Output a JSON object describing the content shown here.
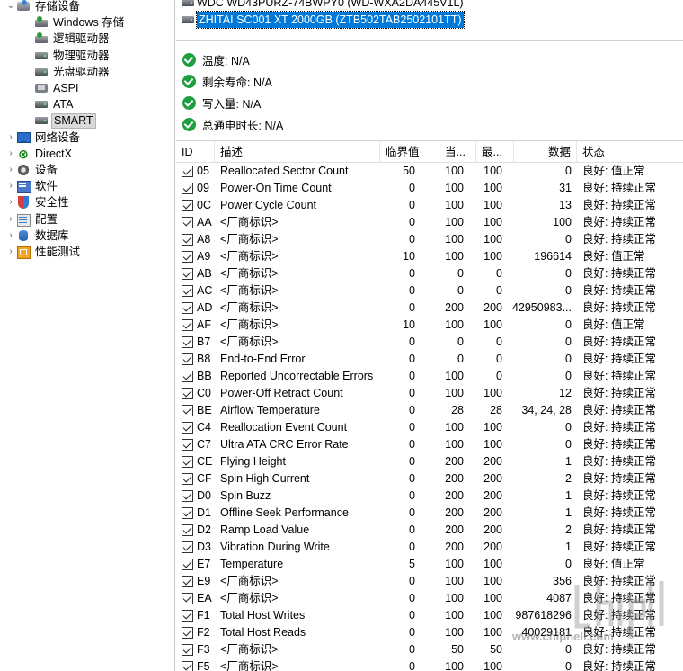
{
  "tree": {
    "items": [
      {
        "label": "存储设备",
        "icon": "storage-icon",
        "expander": "⌄",
        "indent": 0
      },
      {
        "label": "Windows 存储",
        "icon": "disk-green-icon",
        "expander": "",
        "indent": 1
      },
      {
        "label": "逻辑驱动器",
        "icon": "disk-green-icon",
        "expander": "",
        "indent": 1
      },
      {
        "label": "物理驱动器",
        "icon": "disk-icon",
        "expander": "",
        "indent": 1
      },
      {
        "label": "光盘驱动器",
        "icon": "disk-icon",
        "expander": "",
        "indent": 1
      },
      {
        "label": "ASPI",
        "icon": "aspi-icon",
        "expander": "",
        "indent": 1
      },
      {
        "label": "ATA",
        "icon": "disk-icon",
        "expander": "",
        "indent": 1
      },
      {
        "label": "SMART",
        "icon": "disk-icon",
        "expander": "",
        "indent": 1,
        "selected": true
      },
      {
        "label": "网络设备",
        "icon": "network-icon",
        "expander": "›",
        "indent": 0
      },
      {
        "label": "DirectX",
        "icon": "directx-icon",
        "expander": "›",
        "indent": 0
      },
      {
        "label": "设备",
        "icon": "device-icon",
        "expander": "›",
        "indent": 0
      },
      {
        "label": "软件",
        "icon": "software-icon",
        "expander": "›",
        "indent": 0
      },
      {
        "label": "安全性",
        "icon": "security-icon",
        "expander": "›",
        "indent": 0
      },
      {
        "label": "配置",
        "icon": "config-icon",
        "expander": "›",
        "indent": 0
      },
      {
        "label": "数据库",
        "icon": "database-icon",
        "expander": "›",
        "indent": 0
      },
      {
        "label": "性能测试",
        "icon": "benchmark-icon",
        "expander": "›",
        "indent": 0
      }
    ]
  },
  "devices": [
    {
      "label": "WDC WD43PURZ-74BWPY0 (WD-WXA2DA445V1L)",
      "selected": false
    },
    {
      "label": "ZHITAI SC001 XT 2000GB (ZTB502TAB2502101TT)",
      "selected": true
    }
  ],
  "status": [
    {
      "label": "温度: N/A"
    },
    {
      "label": "剩余寿命: N/A"
    },
    {
      "label": "写入量: N/A"
    },
    {
      "label": "总通电时长: N/A"
    }
  ],
  "table": {
    "headers": [
      "ID",
      "描述",
      "临界值",
      "当...",
      "最...",
      "数据",
      "状态"
    ],
    "rows": [
      {
        "id": "05",
        "desc": "Reallocated Sector Count",
        "thr": "50",
        "cur": "100",
        "wst": "100",
        "data": "0",
        "stat": "良好:  值正常"
      },
      {
        "id": "09",
        "desc": "Power-On Time Count",
        "thr": "0",
        "cur": "100",
        "wst": "100",
        "data": "31",
        "stat": "良好:  持续正常"
      },
      {
        "id": "0C",
        "desc": "Power Cycle Count",
        "thr": "0",
        "cur": "100",
        "wst": "100",
        "data": "13",
        "stat": "良好:  持续正常"
      },
      {
        "id": "AA",
        "desc": "<厂商标识>",
        "thr": "0",
        "cur": "100",
        "wst": "100",
        "data": "100",
        "stat": "良好:  持续正常"
      },
      {
        "id": "A8",
        "desc": "<厂商标识>",
        "thr": "0",
        "cur": "100",
        "wst": "100",
        "data": "0",
        "stat": "良好:  持续正常"
      },
      {
        "id": "A9",
        "desc": "<厂商标识>",
        "thr": "10",
        "cur": "100",
        "wst": "100",
        "data": "196614",
        "stat": "良好:  值正常"
      },
      {
        "id": "AB",
        "desc": "<厂商标识>",
        "thr": "0",
        "cur": "0",
        "wst": "0",
        "data": "0",
        "stat": "良好:  持续正常"
      },
      {
        "id": "AC",
        "desc": "<厂商标识>",
        "thr": "0",
        "cur": "0",
        "wst": "0",
        "data": "0",
        "stat": "良好:  持续正常"
      },
      {
        "id": "AD",
        "desc": "<厂商标识>",
        "thr": "0",
        "cur": "200",
        "wst": "200",
        "data": "42950983...",
        "stat": "良好:  持续正常"
      },
      {
        "id": "AF",
        "desc": "<厂商标识>",
        "thr": "10",
        "cur": "100",
        "wst": "100",
        "data": "0",
        "stat": "良好:  值正常"
      },
      {
        "id": "B7",
        "desc": "<厂商标识>",
        "thr": "0",
        "cur": "0",
        "wst": "0",
        "data": "0",
        "stat": "良好:  持续正常"
      },
      {
        "id": "B8",
        "desc": "End-to-End Error",
        "thr": "0",
        "cur": "0",
        "wst": "0",
        "data": "0",
        "stat": "良好:  持续正常"
      },
      {
        "id": "BB",
        "desc": "Reported Uncorrectable Errors",
        "thr": "0",
        "cur": "100",
        "wst": "0",
        "data": "0",
        "stat": "良好:  持续正常"
      },
      {
        "id": "C0",
        "desc": "Power-Off Retract Count",
        "thr": "0",
        "cur": "100",
        "wst": "100",
        "data": "12",
        "stat": "良好:  持续正常"
      },
      {
        "id": "BE",
        "desc": "Airflow Temperature",
        "thr": "0",
        "cur": "28",
        "wst": "28",
        "data": "34, 24, 28",
        "stat": "良好:  持续正常"
      },
      {
        "id": "C4",
        "desc": "Reallocation Event Count",
        "thr": "0",
        "cur": "100",
        "wst": "100",
        "data": "0",
        "stat": "良好:  持续正常"
      },
      {
        "id": "C7",
        "desc": "Ultra ATA CRC Error Rate",
        "thr": "0",
        "cur": "100",
        "wst": "100",
        "data": "0",
        "stat": "良好:  持续正常"
      },
      {
        "id": "CE",
        "desc": "Flying Height",
        "thr": "0",
        "cur": "200",
        "wst": "200",
        "data": "1",
        "stat": "良好:  持续正常"
      },
      {
        "id": "CF",
        "desc": "Spin High Current",
        "thr": "0",
        "cur": "200",
        "wst": "200",
        "data": "2",
        "stat": "良好:  持续正常"
      },
      {
        "id": "D0",
        "desc": "Spin Buzz",
        "thr": "0",
        "cur": "200",
        "wst": "200",
        "data": "1",
        "stat": "良好:  持续正常"
      },
      {
        "id": "D1",
        "desc": "Offline Seek Performance",
        "thr": "0",
        "cur": "200",
        "wst": "200",
        "data": "1",
        "stat": "良好:  持续正常"
      },
      {
        "id": "D2",
        "desc": "Ramp Load Value",
        "thr": "0",
        "cur": "200",
        "wst": "200",
        "data": "2",
        "stat": "良好:  持续正常"
      },
      {
        "id": "D3",
        "desc": "Vibration During Write",
        "thr": "0",
        "cur": "200",
        "wst": "200",
        "data": "1",
        "stat": "良好:  持续正常"
      },
      {
        "id": "E7",
        "desc": "Temperature",
        "thr": "5",
        "cur": "100",
        "wst": "100",
        "data": "0",
        "stat": "良好:  值正常"
      },
      {
        "id": "E9",
        "desc": "<厂商标识>",
        "thr": "0",
        "cur": "100",
        "wst": "100",
        "data": "356",
        "stat": "良好:  持续正常"
      },
      {
        "id": "EA",
        "desc": "<厂商标识>",
        "thr": "0",
        "cur": "100",
        "wst": "100",
        "data": "4087",
        "stat": "良好:  持续正常"
      },
      {
        "id": "F1",
        "desc": "Total Host Writes",
        "thr": "0",
        "cur": "100",
        "wst": "100",
        "data": "987618296",
        "stat": "良好:  持续正常"
      },
      {
        "id": "F2",
        "desc": "Total Host Reads",
        "thr": "0",
        "cur": "100",
        "wst": "100",
        "data": "40029181",
        "stat": "良好:  持续正常"
      },
      {
        "id": "F3",
        "desc": "<厂商标识>",
        "thr": "0",
        "cur": "50",
        "wst": "50",
        "data": "0",
        "stat": "良好:  持续正常"
      },
      {
        "id": "F5",
        "desc": "<厂商标识>",
        "thr": "0",
        "cur": "100",
        "wst": "100",
        "data": "0",
        "stat": "良好:  持续正常"
      }
    ]
  },
  "watermark": {
    "text": "www.chiphell.com"
  }
}
